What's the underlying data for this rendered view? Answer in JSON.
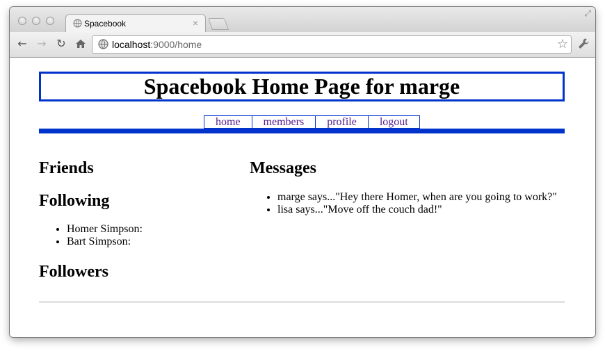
{
  "browser": {
    "tab_title": "Spacebook",
    "tab_close": "×",
    "url_host": "localhost",
    "url_path": ":9000/home",
    "icons": {
      "back": "back-arrow-icon",
      "forward": "forward-arrow-icon",
      "reload": "reload-icon",
      "home": "home-icon",
      "star": "star-icon",
      "wrench": "wrench-icon",
      "globe": "globe-icon"
    }
  },
  "page": {
    "title": "Spacebook Home Page for marge",
    "menu": [
      {
        "label": "home"
      },
      {
        "label": "members"
      },
      {
        "label": "profile"
      },
      {
        "label": "logout"
      }
    ],
    "friends_heading": "Friends",
    "following_heading": "Following",
    "following": [
      "Homer Simpson:",
      "Bart Simpson:"
    ],
    "followers_heading": "Followers",
    "messages_heading": "Messages",
    "messages": [
      "marge says...\"Hey there Homer, when are you going to work?\"",
      "lisa says...\"Move off the couch dad!\""
    ],
    "colors": {
      "accent": "#0033cc",
      "link_visited": "#551a8b"
    }
  }
}
